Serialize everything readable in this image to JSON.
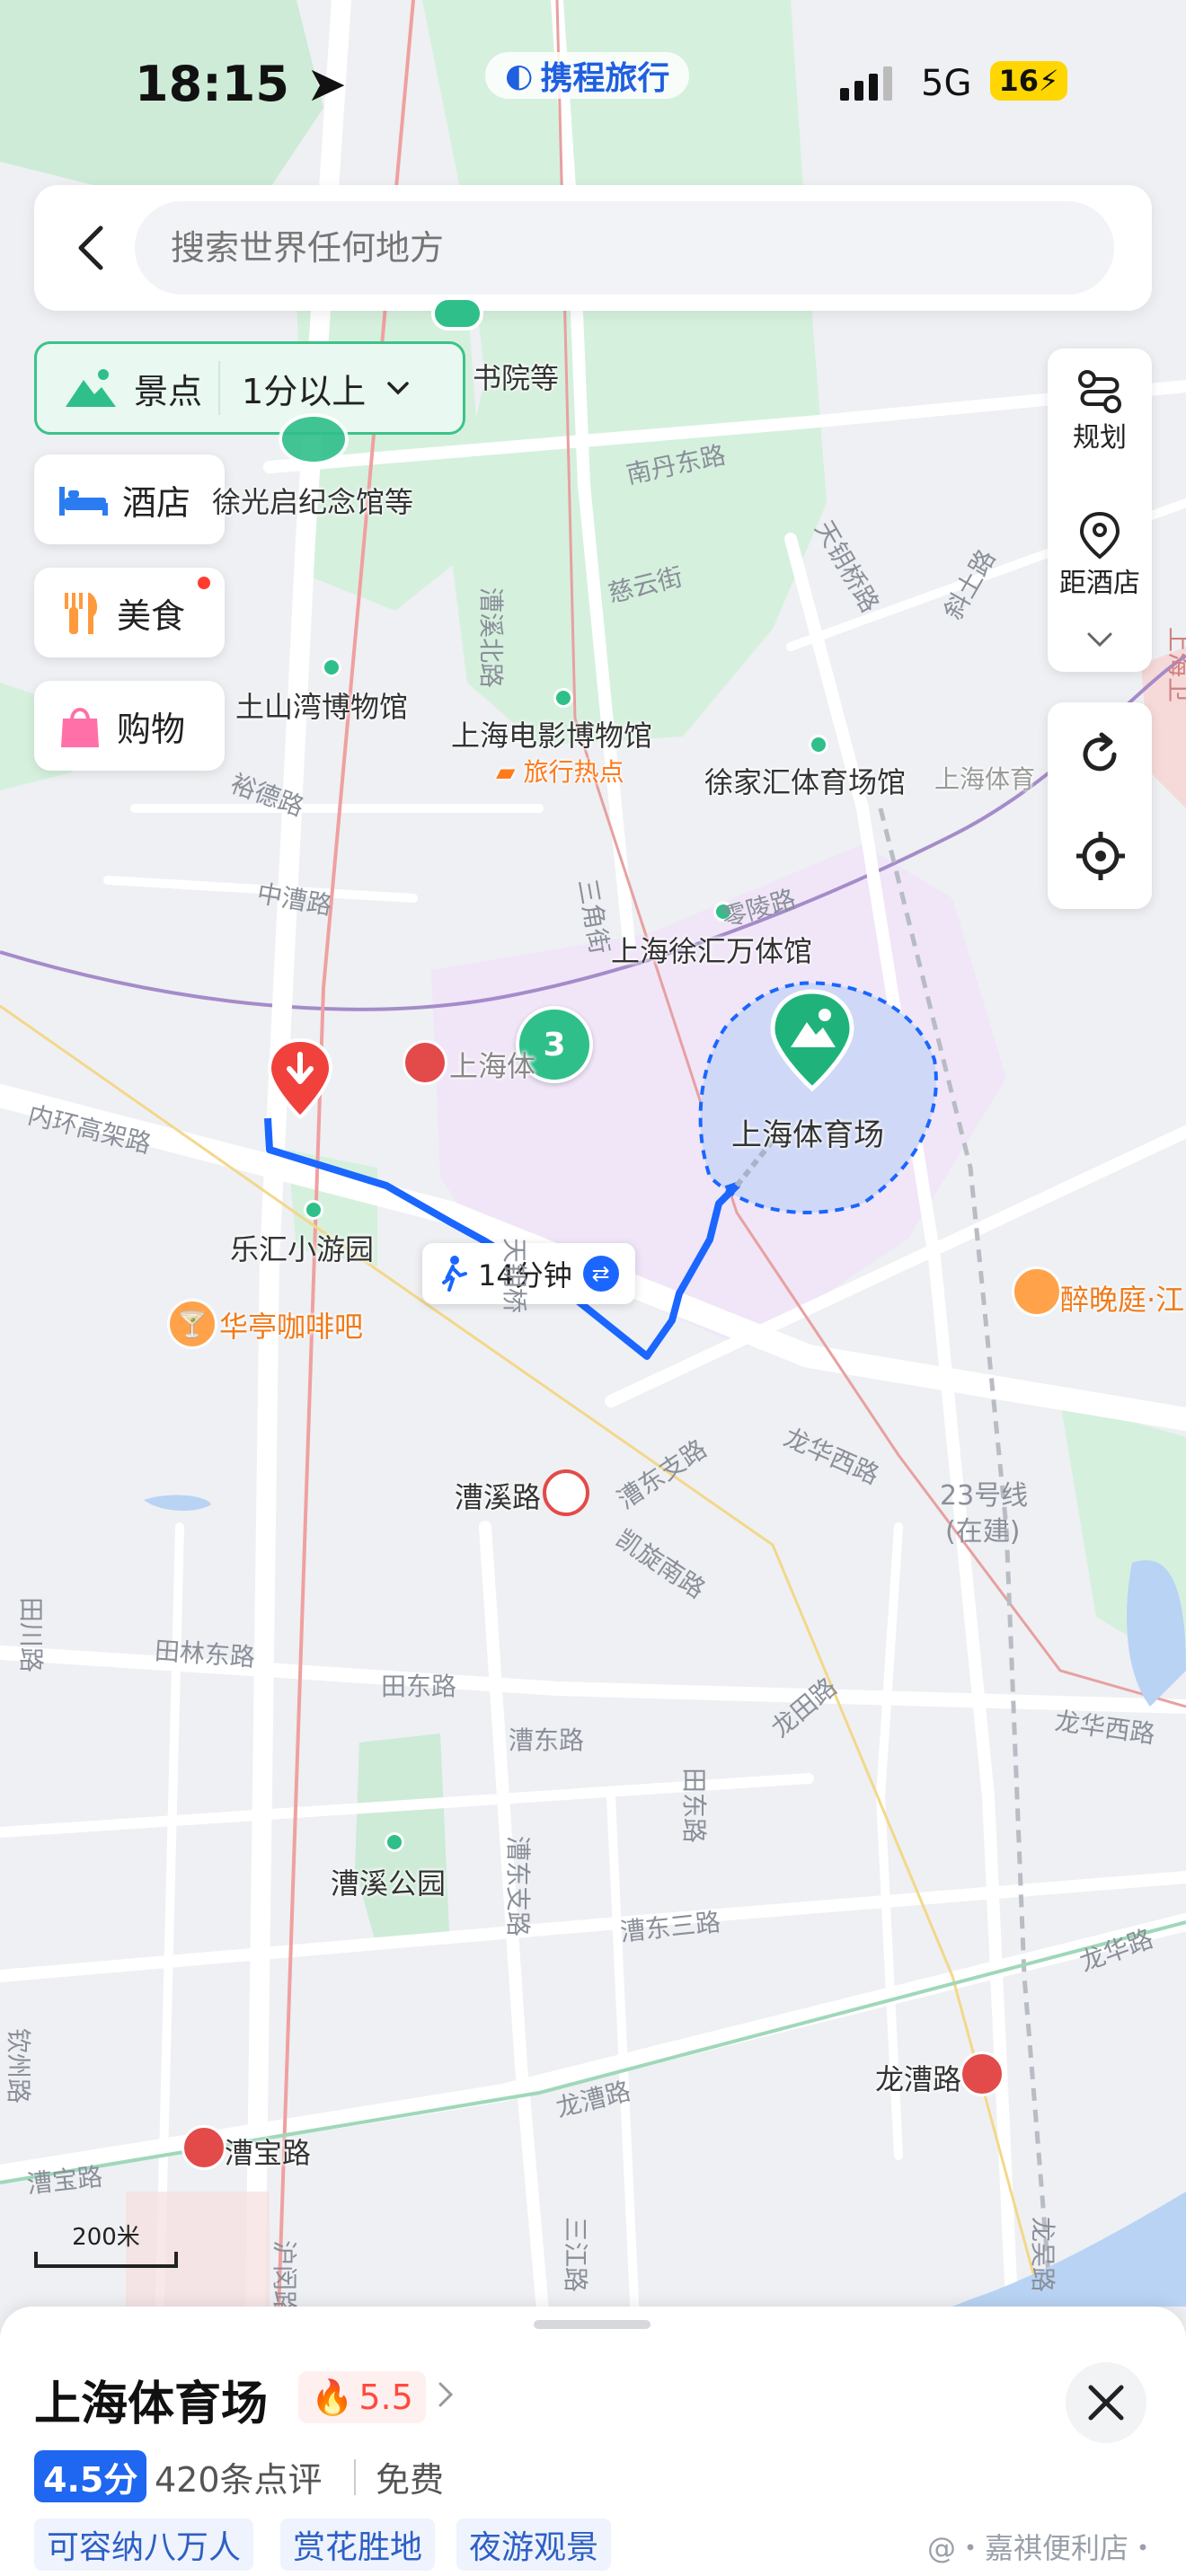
{
  "status_bar": {
    "time": "18:15",
    "network": "5G",
    "battery": "16"
  },
  "brand": {
    "name": "携程旅行"
  },
  "search": {
    "placeholder": "搜索世界任何地方"
  },
  "categories": {
    "active": {
      "label": "景点",
      "filter": "1分以上"
    },
    "items": [
      {
        "label": "酒店"
      },
      {
        "label": "美食"
      },
      {
        "label": "购物"
      }
    ]
  },
  "controls": {
    "plan_label": "规划",
    "hotel_distance_label": "距酒店"
  },
  "map": {
    "labels": {
      "shuyuan": "书院等",
      "xuguangqi": "徐光启纪念馆等",
      "tushanwan": "土山湾博物馆",
      "film_museum": "上海电影博物馆",
      "travel_hot": "旅行热点",
      "xujiahui_stadium": "徐家汇体育场馆",
      "shanghai_sports_cut": "上海体育",
      "wanti": "上海徐汇万体馆",
      "shanghai_stadium": "上海体育场",
      "le_hui_park": "乐汇小游园",
      "huating_cafe": "华亭咖啡吧",
      "zui_wan_ting": "醉晚庭·江",
      "caoxi_station": "漕溪路",
      "line23": "23号线",
      "line23_sub": "(在建)",
      "caoxi_park": "漕溪公园",
      "longcao_station": "龙漕路",
      "caobao_station": "漕宝路",
      "shanghai_cut_station": "上海体",
      "cluster_count": "3"
    },
    "roads": {
      "nandan": "南丹东路",
      "ciyun": "慈云街",
      "tianyao": "天钥桥路",
      "xietu": "斜土路",
      "caoxi_north": "漕溪北路",
      "yude": "裕德路",
      "zhongcao": "中漕路",
      "lingling": "零陵路",
      "sanjiao": "三角街",
      "inner_ring": "内环高架路",
      "longhua_west": "龙华西路",
      "caodong_zhi": "漕东支路",
      "kaixuan": "凯旋南路",
      "tianlin_east": "田林东路",
      "tiandong": "田东路",
      "caodong": "漕东路",
      "longtian": "龙田路",
      "tiandong2": "田东路",
      "caodong_zhi2": "漕东支路",
      "caodong3": "漕东三路",
      "longcao": "龙漕路",
      "longhua": "龙华路",
      "longhua_middle": "龙华西路",
      "caobao": "漕宝路",
      "qinzhou": "钦州路",
      "tianchuan": "田川路",
      "humin": "沪闵路",
      "sanjiang": "三江路",
      "longwu": "龙吴路",
      "tianyao2": "天钥桥",
      "shangyao": "上海卫"
    },
    "walk_time": "14分钟",
    "scale": "200米"
  },
  "place": {
    "name": "上海体育场",
    "heat": "5.5",
    "score": "4.5分",
    "reviews": "420条点评",
    "price": "免费",
    "tags": [
      "可容纳八万人",
      "赏花胜地",
      "夜游观景"
    ]
  },
  "watermark": "@・嘉祺便利店・",
  "colors": {
    "accent_green": "#2fbf8a",
    "route_blue": "#1a66ff",
    "brand_blue": "#1f66f0",
    "heat_red": "#ff4a3d"
  }
}
